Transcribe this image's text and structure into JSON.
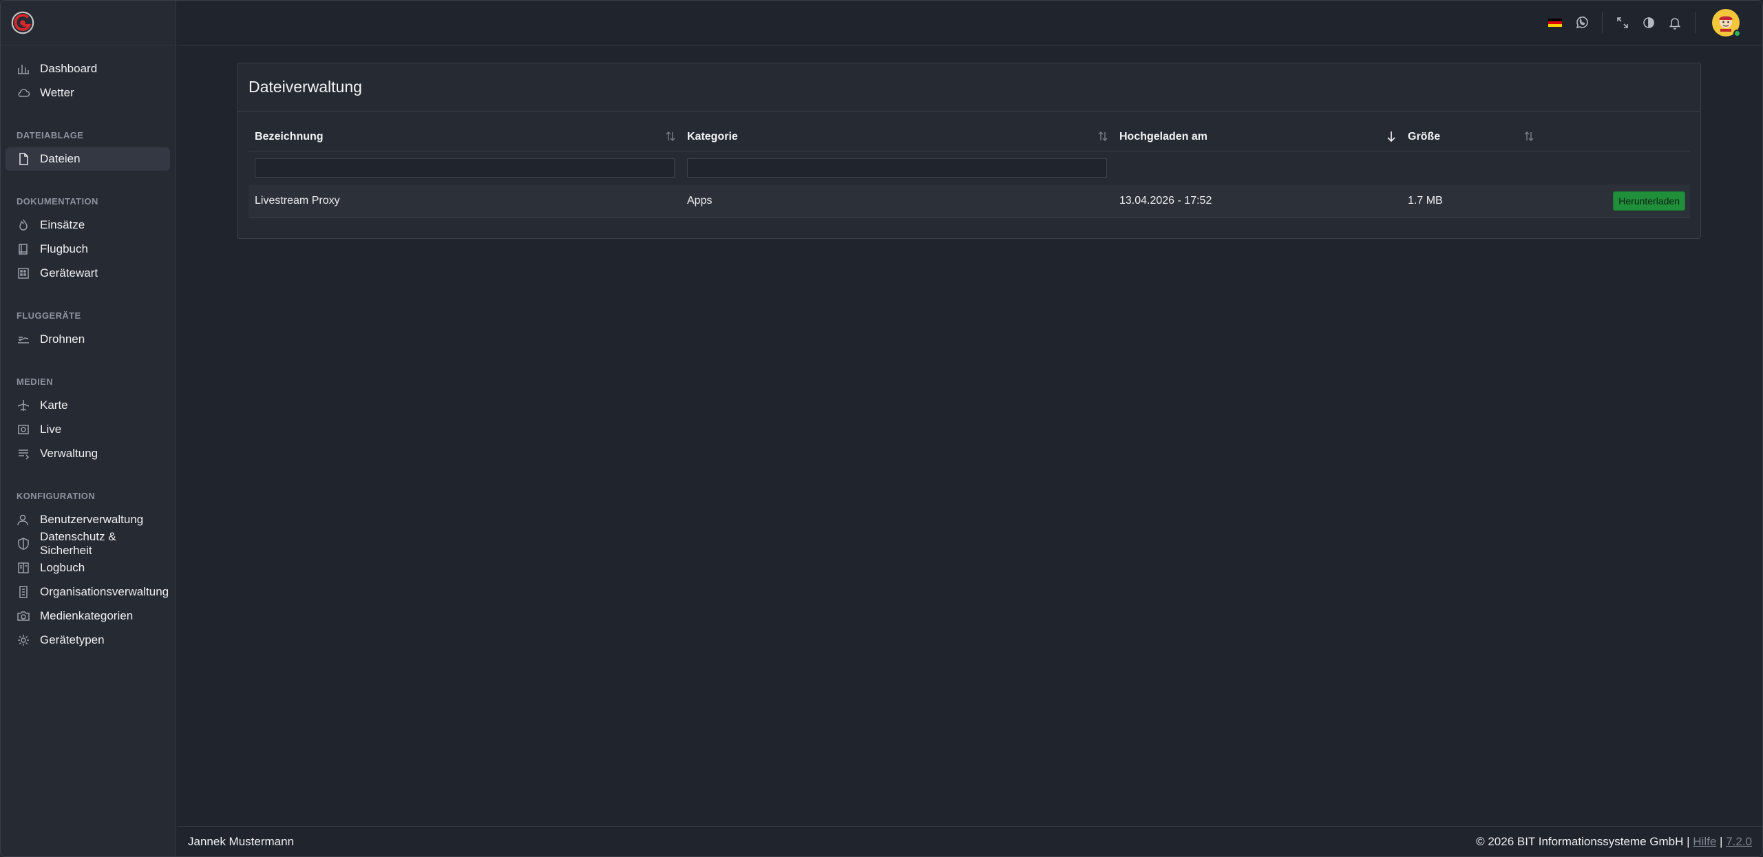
{
  "sidebar": {
    "top_items": [
      {
        "label": "Dashboard",
        "icon": "chart-icon"
      },
      {
        "label": "Wetter",
        "icon": "cloud-icon"
      }
    ],
    "sections": [
      {
        "title": "DATEIABLAGE",
        "items": [
          {
            "label": "Dateien",
            "icon": "file-icon",
            "active": true
          }
        ]
      },
      {
        "title": "DOKUMENTATION",
        "items": [
          {
            "label": "Einsätze",
            "icon": "flame-icon"
          },
          {
            "label": "Flugbuch",
            "icon": "book-icon"
          },
          {
            "label": "Gerätewart",
            "icon": "building-icon"
          }
        ]
      },
      {
        "title": "FLUGGERÄTE",
        "items": [
          {
            "label": "Drohnen",
            "icon": "drone-icon"
          }
        ]
      },
      {
        "title": "MEDIEN",
        "items": [
          {
            "label": "Karte",
            "icon": "plane-icon"
          },
          {
            "label": "Live",
            "icon": "camera-icon"
          },
          {
            "label": "Verwaltung",
            "icon": "list-icon"
          }
        ]
      },
      {
        "title": "KONFIGURATION",
        "items": [
          {
            "label": "Benutzerverwaltung",
            "icon": "users-icon"
          },
          {
            "label": "Datenschutz & Sicherheit",
            "icon": "shield-icon"
          },
          {
            "label": "Logbuch",
            "icon": "logbook-icon"
          },
          {
            "label": "Organisationsverwaltung",
            "icon": "org-icon"
          },
          {
            "label": "Medienkategorien",
            "icon": "photo-icon"
          },
          {
            "label": "Gerätetypen",
            "icon": "gear-icon"
          }
        ]
      }
    ]
  },
  "header": {
    "flag_colors": [
      "#000000",
      "#dd0000",
      "#ffce00"
    ]
  },
  "card": {
    "title": "Dateiverwaltung",
    "columns": [
      "Bezeichnung",
      "Kategorie",
      "Hochgeladen am",
      "Größe"
    ],
    "filter_values": [
      "",
      ""
    ],
    "rows": [
      {
        "name": "Livestream Proxy",
        "category": "Apps",
        "uploaded": "13.04.2026 - 17:52",
        "size": "1.7 MB",
        "action": "Herunterladen"
      }
    ]
  },
  "footer": {
    "user": "Jannek Mustermann",
    "copyright": "© 2026 BIT Informationssysteme GmbH |",
    "help": "Hilfe",
    "separator": "|",
    "version": "7.2.0"
  },
  "colors": {
    "accent_green": "#1f8f3a",
    "background": "#20242c",
    "sidebar": "#262a32"
  }
}
